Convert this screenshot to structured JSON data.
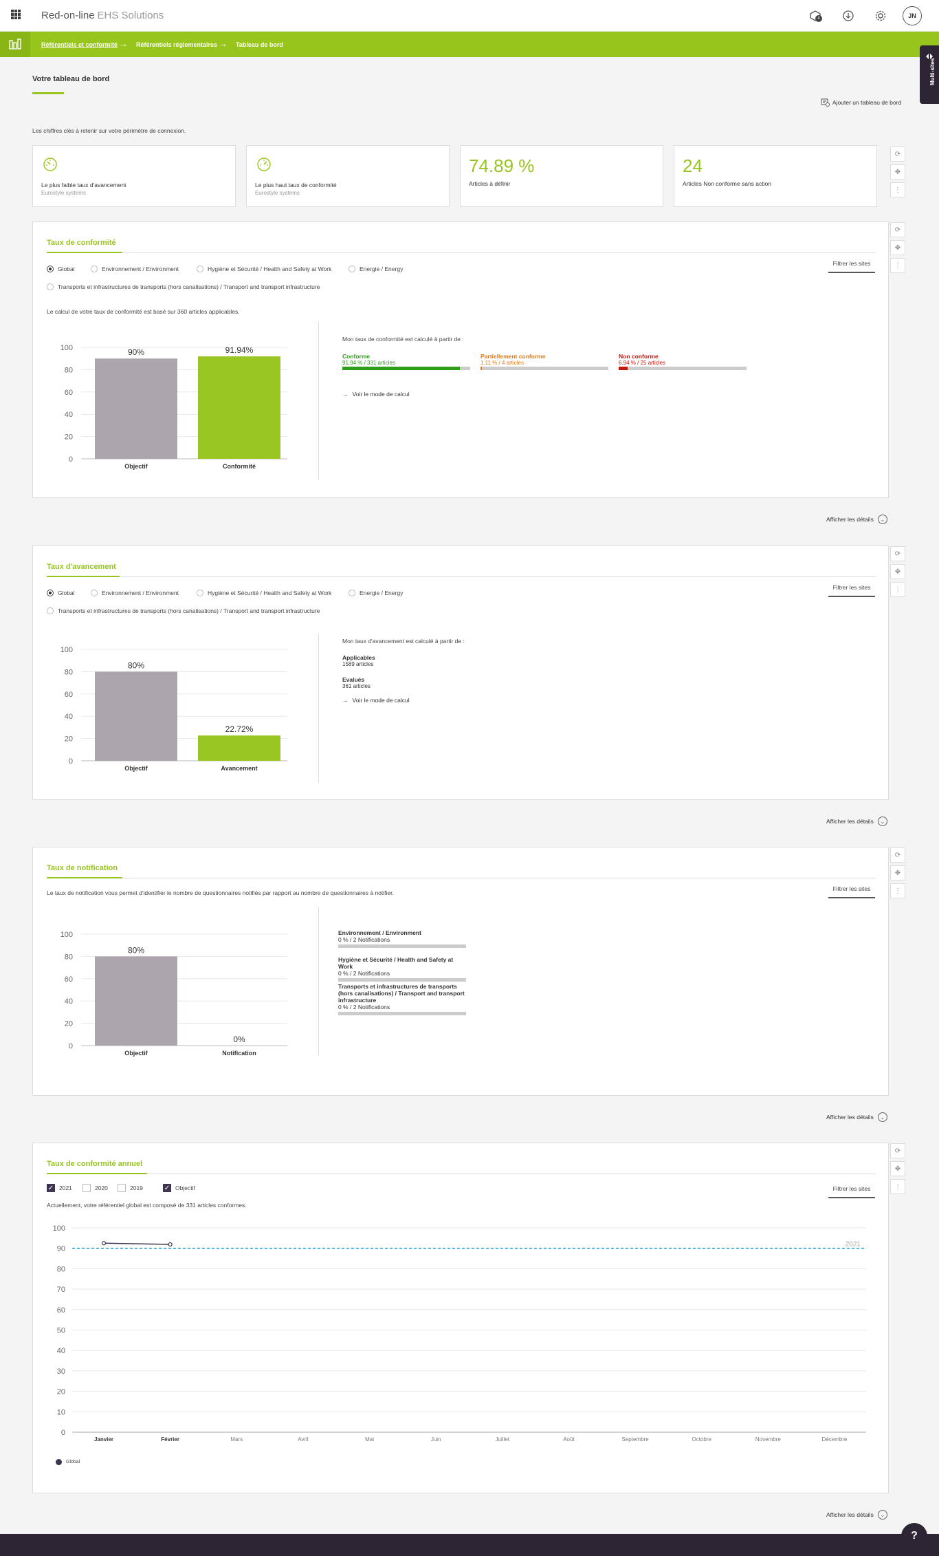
{
  "header": {
    "logo_main": "Red-on-line",
    "logo_sub": "EHS Solutions",
    "notification_count": "4",
    "user_initials": "JN"
  },
  "breadcrumb": [
    "Référentiels et conformité",
    "Référentiels réglementaires",
    "Tableau de bord"
  ],
  "multisites": "Multi-sites",
  "page": {
    "title": "Votre tableau de bord",
    "add_dashboard": "Ajouter un tableau de bord",
    "intro": "Les chiffres clés à retenir sur votre périmètre de connexion."
  },
  "kpis": [
    {
      "label": "Le plus faible taux d'avancement",
      "sub": "Eurostyle systems"
    },
    {
      "label": "Le plus haut taux de conformité",
      "sub": "Eurostyle systems"
    },
    {
      "value": "74.89 %",
      "label": "Articles à définir"
    },
    {
      "value": "24",
      "label": "Articles Non conforme sans action"
    }
  ],
  "filters": {
    "radios": [
      "Global",
      "Environnement / Environment",
      "Hygiène et Sécurité / Health and Safety at Work",
      "Energie / Energy",
      "Transports et infrastructures de transports (hors canalisations) / Transport and transport infrastructure"
    ],
    "filter_sites": "Filtrer les sites",
    "show_details": "Afficher les détails",
    "see_calc": "Voir le mode de calcul"
  },
  "conformite": {
    "title": "Taux de conformité",
    "desc": "Le calcul de votre taux de conformité est basé sur 360 articles applicables.",
    "calc_intro": "Mon taux de conformité est calculé à partir de :",
    "rates": [
      {
        "label": "Conforme",
        "detail": "91.94 % / 331 articles",
        "percent": 91.94,
        "color": "#2e9e1a"
      },
      {
        "label": "Partiellement conforme",
        "detail": "1.11 % / 4 articles",
        "percent": 1.11,
        "color": "#e07b20"
      },
      {
        "label": "Non conforme",
        "detail": "6.94 % / 25 articles",
        "percent": 6.94,
        "color": "#c0170f"
      }
    ]
  },
  "avancement": {
    "title": "Taux d'avancement",
    "calc_intro": "Mon taux d'avancement est calculé à partir de :",
    "applicables_label": "Applicables",
    "applicables_value": "1589 articles",
    "evalues_label": "Evalués",
    "evalues_value": "361 articles"
  },
  "notification": {
    "title": "Taux de notification",
    "desc": "Le taux de notification vous permet d'identifier le nombre de questionnaires notifiés par rapport au nombre de questionnaires à notifier.",
    "items": [
      {
        "label": "Environnement / Environment",
        "detail": "0 % / 2 Notifications"
      },
      {
        "label": "Hygiène et Sécurité / Health and Safety at Work",
        "detail": "0 % / 2 Notifications"
      },
      {
        "label": "Transports et infrastructures de transports (hors canalisations) / Transport and transport infrastructure",
        "detail": "0 % / 2 Notifications"
      }
    ]
  },
  "annuel": {
    "title": "Taux de conformité annuel",
    "checks": [
      {
        "label": "2021",
        "checked": true
      },
      {
        "label": "2020",
        "checked": false
      },
      {
        "label": "2019",
        "checked": false
      },
      {
        "label": "Objectif",
        "checked": true
      }
    ],
    "desc": "Actuellement, votre référentiel global est composé de 331 articles conformes.",
    "legend": "Global"
  },
  "chart_data": [
    {
      "type": "bar",
      "categories": [
        "Objectif",
        "Conformité"
      ],
      "values": [
        90,
        91.94
      ],
      "labels": [
        "90%",
        "91.94%"
      ],
      "colors": [
        "#aca5ae",
        "#9ac624"
      ],
      "ylim": [
        0,
        100
      ],
      "yticks": [
        0,
        20,
        40,
        60,
        80,
        100
      ]
    },
    {
      "type": "bar",
      "categories": [
        "Objectif",
        "Avancement"
      ],
      "values": [
        80,
        22.72
      ],
      "labels": [
        "80%",
        "22.72%"
      ],
      "colors": [
        "#aca5ae",
        "#9ac624"
      ],
      "ylim": [
        0,
        100
      ],
      "yticks": [
        0,
        20,
        40,
        60,
        80,
        100
      ]
    },
    {
      "type": "bar",
      "categories": [
        "Objectif",
        "Notification"
      ],
      "values": [
        80,
        0
      ],
      "labels": [
        "80%",
        "0%"
      ],
      "colors": [
        "#aca5ae",
        "#9ac624"
      ],
      "ylim": [
        0,
        100
      ],
      "yticks": [
        0,
        20,
        40,
        60,
        80,
        100
      ]
    },
    {
      "type": "line",
      "categories": [
        "Janvier",
        "Février",
        "Mars",
        "Avril",
        "Mai",
        "Juin",
        "Juillet",
        "Août",
        "Septembre",
        "Octobre",
        "Novembre",
        "Décembre"
      ],
      "series": [
        {
          "name": "Global",
          "values": [
            92.5,
            91.9
          ],
          "color": "#3e3650"
        }
      ],
      "target": {
        "value": 90,
        "label": "2021",
        "color": "#2aa0d8"
      },
      "ylim": [
        0,
        100
      ],
      "yticks": [
        0,
        10,
        20,
        30,
        40,
        50,
        60,
        70,
        80,
        90,
        100
      ]
    }
  ]
}
